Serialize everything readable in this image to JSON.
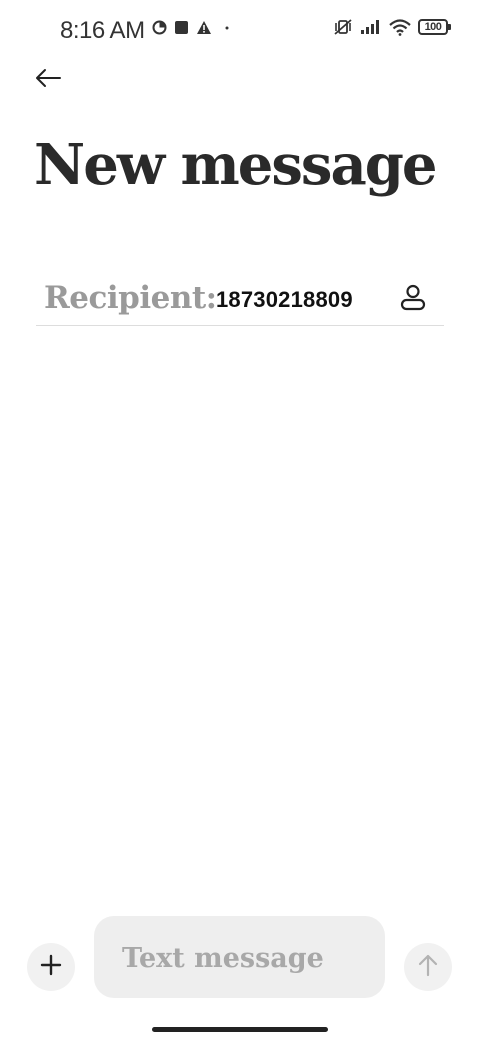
{
  "status_bar": {
    "time": "8:16 AM",
    "battery": "100",
    "left_icons": [
      "data-saver-icon",
      "square-notification-icon",
      "warning-icon",
      "dot-icon"
    ],
    "right_icons": [
      "mute-vibrate-icon",
      "signal-icon",
      "wifi-icon",
      "battery-icon"
    ]
  },
  "header": {
    "back_icon": "arrow-left-icon",
    "title": "New message"
  },
  "recipient": {
    "label": "Recipient:",
    "value": "18730218809",
    "contact_icon": "person-icon"
  },
  "composer": {
    "add_icon": "plus-icon",
    "placeholder": "Text message",
    "value": "",
    "send_icon": "arrow-up-icon"
  },
  "colors": {
    "background": "#ffffff",
    "text": "#222222",
    "muted": "#9a9a9a",
    "field_bg": "#eeeeee",
    "divider": "#dddddd"
  }
}
